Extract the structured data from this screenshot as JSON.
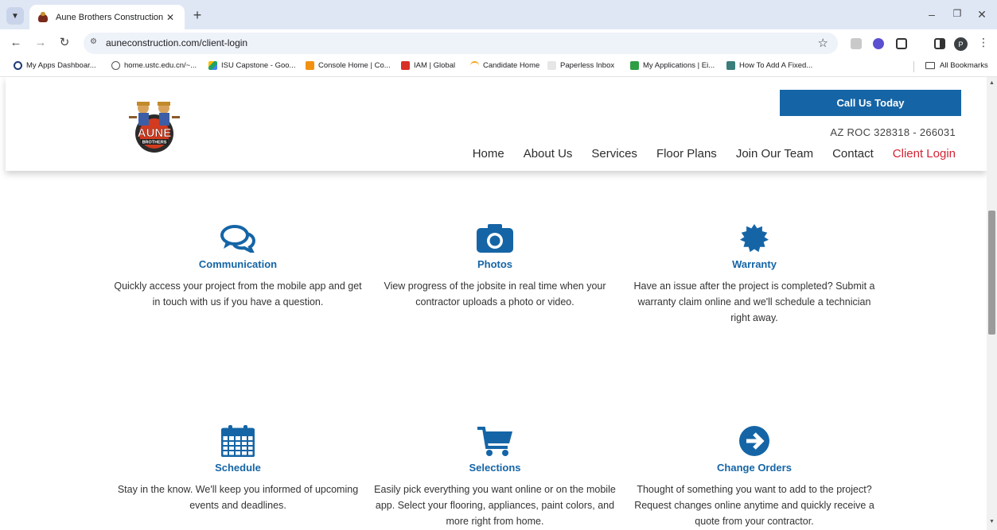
{
  "browser": {
    "tab_title": "Aune Brothers Construction",
    "url": "auneconstruction.com/client-login",
    "profile_initial": "P",
    "bookmarks": [
      {
        "label": "My Apps Dashboar...",
        "color": "#1f3b73"
      },
      {
        "label": "home.ustc.edu.cn/~...",
        "color": "#555555"
      },
      {
        "label": "ISU Capstone - Goo...",
        "color": "#1fa463"
      },
      {
        "label": "Console Home | Co...",
        "color": "#f29111"
      },
      {
        "label": "IAM | Global",
        "color": "#d93025"
      },
      {
        "label": "Candidate Home",
        "color": "#0f6cbd"
      },
      {
        "label": "Paperless Inbox",
        "color": "#7a7a7a"
      },
      {
        "label": "My Applications | Ei...",
        "color": "#2e9e44"
      },
      {
        "label": "How To Add A Fixed...",
        "color": "#3a7d7a"
      }
    ],
    "all_bookmarks": "All Bookmarks"
  },
  "header": {
    "cta": "Call Us Today",
    "roc": "AZ ROC 328318 - 266031",
    "logo_text": "AUNE",
    "logo_subtext": "BROTHERS",
    "nav": [
      "Home",
      "About Us",
      "Services",
      "Floor Plans",
      "Join Our Team",
      "Contact",
      "Client Login"
    ],
    "active_nav": "Client Login"
  },
  "features": [
    {
      "icon": "chat-bubbles-icon",
      "title": "Communication",
      "desc": "Quickly access your project from the mobile app and get in touch with us if you have a question."
    },
    {
      "icon": "camera-icon",
      "title": "Photos",
      "desc": "View progress of the jobsite in real time when your contractor uploads a photo or video."
    },
    {
      "icon": "badge-certificate-icon",
      "title": "Warranty",
      "desc": "Have an issue after the project is completed? Submit a warranty claim online and we'll schedule a technician right away."
    },
    {
      "icon": "calendar-icon",
      "title": "Schedule",
      "desc": "Stay in the know. We'll keep you informed of upcoming events and deadlines."
    },
    {
      "icon": "shopping-cart-icon",
      "title": "Selections",
      "desc": "Easily pick everything you want online or on the mobile app. Select your flooring, appliances, paint colors, and more right from home."
    },
    {
      "icon": "arrow-circle-right-icon",
      "title": "Change Orders",
      "desc": "Thought of something you want to add to the project? Request changes online anytime and quickly receive a quote from your contractor."
    }
  ],
  "colors": {
    "brand_blue": "#1565a6",
    "active_red": "#d32333"
  }
}
